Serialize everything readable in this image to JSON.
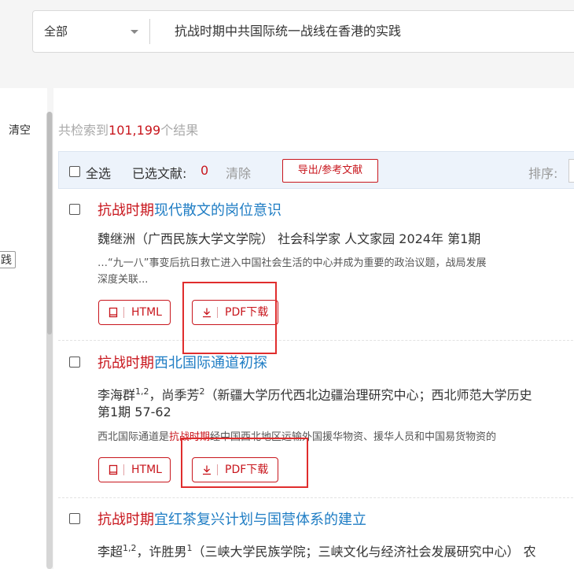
{
  "search": {
    "scope": "全部",
    "query": "抗战时期中共国际统一战线在香港的实践"
  },
  "left_panel": {
    "clear_label": "清空",
    "button_text": "践"
  },
  "results": {
    "count_prefix": "共检索到",
    "count": "101,199",
    "count_suffix": "个结果"
  },
  "toolbar": {
    "select_all": "全选",
    "selected_label": "已选文献:",
    "selected_count": "0",
    "clear": "清除",
    "export": "导出/参考文献",
    "sort_label": "排序:"
  },
  "buttons": {
    "html": "HTML",
    "pdf": "PDF下载"
  },
  "items": [
    {
      "title_hl": "抗战时期",
      "title_rest": "现代散文的岗位意识",
      "meta_line1": "魏继洲（广西民族大学文学院） 社会科学家 人文家园  2024年 第1期",
      "abstract_line1": "…“九一八”事变后抗日救亡进入中国社会生活的中心并成为重要的政治议题，战局发展",
      "abstract_line2": "深度关联..."
    },
    {
      "title_hl": "抗战时期",
      "title_rest": "西北国际通道初探",
      "author1": "李海群",
      "author1_sup": "1,2",
      "author_sep": "，",
      "author2": "尚季芳",
      "author2_sup": "2",
      "meta_rest": "（新疆大学历代西北边疆治理研究中心；西北师范大学历史",
      "meta_line2": "第1期 57-62",
      "abstract_pre": "西北国际通道是",
      "abstract_hl": "抗战时期",
      "abstract_post": "经中国西北地区运输外国援华物资、援华人员和中国易货物资的"
    },
    {
      "title_hl": "抗战时期",
      "title_rest": "宜红茶复兴计划与国营体系的建立",
      "author1": "李超",
      "author1_sup": "1,2",
      "author_sep": "，",
      "author2": "许胜男",
      "author2_sup": "1",
      "meta_rest": "（三峡大学民族学院；三峡文化与经济社会发展研究中心） 农"
    }
  ],
  "colors": {
    "highlight": "#c8161d",
    "link": "#1f7dc4",
    "annotation_box": "#e02d2d"
  }
}
